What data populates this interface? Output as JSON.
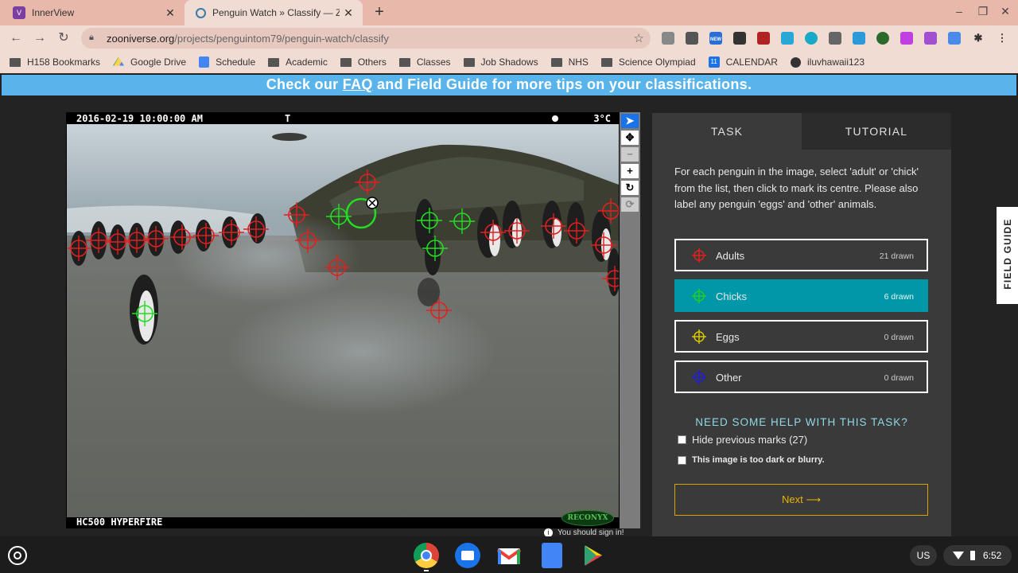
{
  "browser": {
    "tabs": [
      {
        "title": "InnerView",
        "icon": "innerview-icon",
        "active": false
      },
      {
        "title": "Penguin Watch » Classify — Zoo",
        "icon": "zooniverse-icon",
        "active": true
      }
    ],
    "url_domain": "zooniverse.org",
    "url_path": "/projects/penguintom79/penguin-watch/classify",
    "extension_badge_new": "NEW",
    "bookmarks": [
      {
        "label": "H158 Bookmarks",
        "icon": "folder-icon"
      },
      {
        "label": "Google Drive",
        "icon": "google-drive-icon"
      },
      {
        "label": "Schedule",
        "icon": "docs-icon"
      },
      {
        "label": "Academic",
        "icon": "folder-icon"
      },
      {
        "label": "Others",
        "icon": "folder-icon"
      },
      {
        "label": "Classes",
        "icon": "folder-icon"
      },
      {
        "label": "Job Shadows",
        "icon": "folder-icon"
      },
      {
        "label": "NHS",
        "icon": "folder-icon"
      },
      {
        "label": "Science Olympiad",
        "icon": "folder-icon"
      },
      {
        "label": "CALENDAR",
        "icon": "calendar-icon"
      },
      {
        "label": "iluvhawaii123",
        "icon": "globe-icon"
      }
    ]
  },
  "page": {
    "banner_before": "Check our ",
    "banner_link": "FAQ",
    "banner_after": " and Field Guide for more tips on your classifications.",
    "camera": {
      "timestamp": "2016-02-19 10:00:00 AM",
      "flag": "T",
      "temperature": "3°C",
      "model": "HC500 HYPERFIRE",
      "brand": "RECONYX"
    },
    "sign_in_note": "You should sign in!",
    "task_tabs": [
      "TASK",
      "TUTORIAL"
    ],
    "instructions": "For each penguin in the image, select 'adult' or 'chick' from the list, then click to mark its centre. Please also label any penguin 'eggs' and 'other' animals.",
    "choices": [
      {
        "label": "Adults",
        "count": "21 drawn",
        "color": "#e02020",
        "selected": false
      },
      {
        "label": "Chicks",
        "count": "6 drawn",
        "color": "#22cc22",
        "selected": true
      },
      {
        "label": "Eggs",
        "count": "0 drawn",
        "color": "#d8c800",
        "selected": false
      },
      {
        "label": "Other",
        "count": "0 drawn",
        "color": "#2020d0",
        "selected": false
      }
    ],
    "help_heading": "NEED SOME HELP WITH THIS TASK?",
    "hide_marks_label": "Hide previous marks (27)",
    "too_dark_label": "This image is too dark or blurry.",
    "next_label": "Next ⟶",
    "field_guide_label": "FIELD GUIDE",
    "marks": {
      "adult_color": "#e02020",
      "chick_color": "#22dd22",
      "adults_drawn": 21,
      "chicks_drawn": 6
    }
  },
  "shelf": {
    "apps": [
      "chrome-icon",
      "files-icon",
      "gmail-icon",
      "docs-icon",
      "play-store-icon"
    ],
    "language": "US",
    "time": "6:52"
  }
}
